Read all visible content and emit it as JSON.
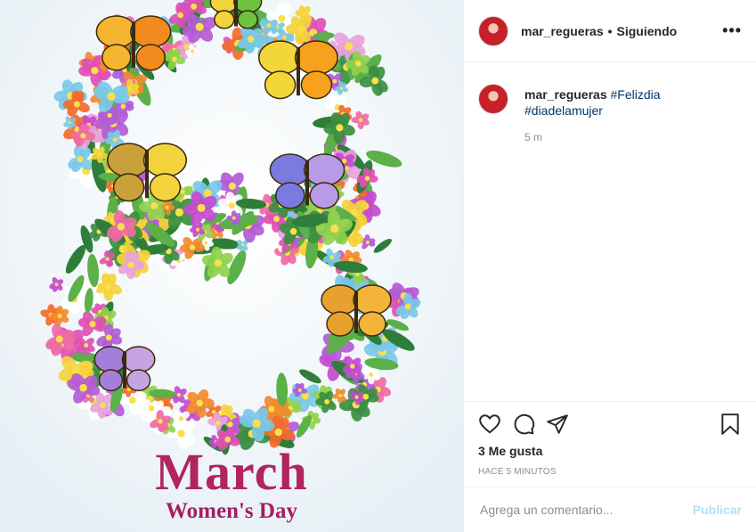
{
  "post": {
    "image": {
      "description_title": "March",
      "description_subtitle": "Women's Day",
      "colors": {
        "title": "#b0245f",
        "background": "#eef4f8"
      }
    },
    "header": {
      "username": "mar_regueras",
      "separator": "•",
      "follow_status": "Siguiendo",
      "more_icon": "ellipsis-icon",
      "more_label": "•••"
    },
    "caption": {
      "username": "mar_regueras",
      "hashtags": [
        "#Felizdia",
        "#diadelamujer"
      ],
      "time": "5 m"
    },
    "actions": {
      "icons": [
        "heart-icon",
        "comment-icon",
        "share-icon",
        "bookmark-icon"
      ]
    },
    "likes": "3 Me gusta",
    "posted_ago": "HACE 5 MINUTOS",
    "composer": {
      "placeholder": "Agrega un comentario...",
      "publish_label": "Publicar"
    },
    "accent_colors": {
      "link": "#00376b",
      "publish_disabled": "#b2dffc",
      "muted": "#8e8e8e"
    }
  }
}
